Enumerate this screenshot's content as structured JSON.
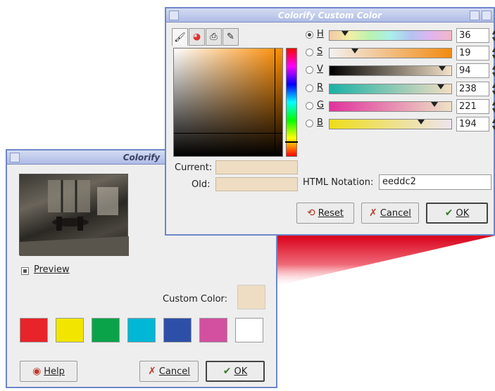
{
  "colorify": {
    "title": "Colorify",
    "preview_label": "Preview",
    "preview_checked": true,
    "custom_color_label": "Custom Color:",
    "custom_color": "#eeddc2",
    "swatches": [
      "#e8232a",
      "#f2e600",
      "#0aa34a",
      "#00b7d6",
      "#2d4fa8",
      "#d2509f",
      "#ffffff"
    ],
    "help_label": "Help",
    "cancel_label": "Cancel",
    "ok_label": "OK"
  },
  "custom": {
    "title": "Colorify Custom Color",
    "channels": [
      {
        "name": "H",
        "value": "36",
        "selected": true,
        "level": 0.1
      },
      {
        "name": "S",
        "value": "19",
        "selected": false,
        "level": 0.19
      },
      {
        "name": "V",
        "value": "94",
        "selected": false,
        "level": 0.94
      },
      {
        "name": "R",
        "value": "238",
        "selected": false,
        "level": 0.93
      },
      {
        "name": "G",
        "value": "221",
        "selected": false,
        "level": 0.87
      },
      {
        "name": "B",
        "value": "194",
        "selected": false,
        "level": 0.76
      }
    ],
    "current_label": "Current:",
    "old_label": "Old:",
    "html_label": "HTML Notation:",
    "html_value": "eeddc2",
    "reset_label": "Reset",
    "cancel_label": "Cancel",
    "ok_label": "OK",
    "current_color": "#eeddc2",
    "old_color": "#eeddc2"
  }
}
